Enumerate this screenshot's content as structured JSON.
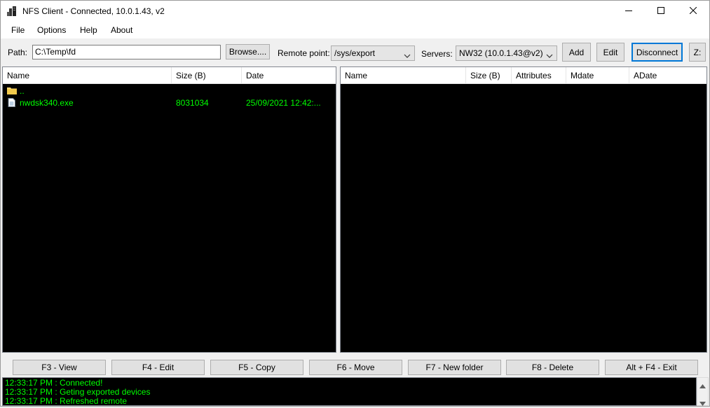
{
  "window": {
    "title": "NFS Client - Connected, 10.0.1.43, v2",
    "icons": {
      "app": "nfs-client-icon",
      "minimize": "minimize-icon",
      "maximize": "maximize-icon",
      "close": "close-icon"
    }
  },
  "menu": [
    "File",
    "Options",
    "Help",
    "About"
  ],
  "toolbar": {
    "path_label": "Path:",
    "path_value": "C:\\Temp\\fd",
    "browse_label": "Browse....",
    "remote_label": "Remote point:",
    "remote_value": "/sys/export",
    "servers_label": "Servers:",
    "servers_value": "NW32  (10.0.1.43@v2)",
    "add_label": "Add",
    "edit_label": "Edit",
    "disconnect_label": "Disconnect",
    "drive_label": "Z:"
  },
  "local": {
    "columns": [
      "Name",
      "Size (B)",
      "Date"
    ],
    "rows": [
      {
        "icon": "folder-icon",
        "name": "..",
        "size": "",
        "date": ""
      },
      {
        "icon": "file-icon",
        "name": "nwdsk340.exe",
        "size": "8031034",
        "date": "25/09/2021 12:42:..."
      }
    ]
  },
  "remote": {
    "columns": [
      "Name",
      "Size (B)",
      "Attributes",
      "Mdate",
      "ADate"
    ],
    "rows": []
  },
  "function_keys": [
    "F3 - View",
    "F4 - Edit",
    "F5 - Copy",
    "F6 - Move",
    "F7 - New folder",
    "F8 - Delete",
    "Alt + F4 - Exit"
  ],
  "log": [
    "12:33:17 PM : Connected!",
    "12:33:17 PM : Geting exported devices",
    "12:33:17 PM : Refreshed remote"
  ],
  "colors": {
    "list_background": "#000000",
    "list_text": "#00ff00",
    "accent": "#0078d7"
  }
}
